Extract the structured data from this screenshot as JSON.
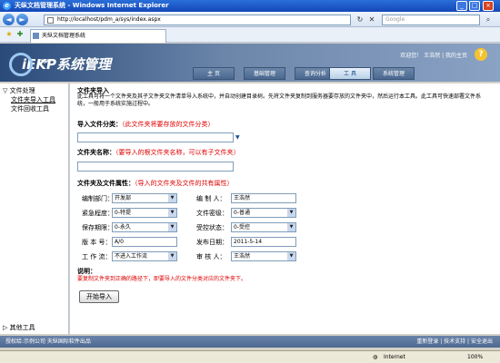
{
  "window": {
    "title": "天纵文档管理系统 - Windows Internet Explorer",
    "min": "_",
    "max": "□",
    "close": "×"
  },
  "browser": {
    "back": "◄",
    "forward": "►",
    "url": "http://localhost/pdm_a/sys/index.aspx",
    "refresh": "↻",
    "stop": "✕",
    "search_placeholder": "Google",
    "tab_title": "天纵文档管理系统",
    "fav_star": "★",
    "add_fav": "✚"
  },
  "header": {
    "logo_text": "iEKP系统管理",
    "logo_tm": "TM",
    "user": "欢迎您！ 王浩然",
    "links": "| 我的主页",
    "help": "?"
  },
  "nav_tabs": [
    {
      "label": "主  页"
    },
    {
      "label": "基础管理"
    },
    {
      "label": "查询分析"
    },
    {
      "label": "工  具"
    },
    {
      "label": "系统管理"
    }
  ],
  "sidebar": {
    "group1": "▽ 文件处理",
    "item1": "文件夹导入工具",
    "item2": "文件回收工具",
    "group2": "▷ 其他工具"
  },
  "main": {
    "title": "文件夹导入",
    "desc": "此工具可将一个文件夹及其子文件夹文件清单导入系统中，并自动创建目录树。先将文件夹复制到服务器要存放的文件夹中，然后运行本工具。此工具可快速部署文件系统，一般用于系统实施过程中。",
    "cat_label": "导入文件分类：",
    "cat_hint": "（此文件夹将要存放的文件分类）",
    "cat_value": "",
    "name_label": "文件夹名称：",
    "name_hint": "（要导入的根文件夹名称，可以有子文件夹）",
    "name_value": "",
    "attr_label": "文件夹及文件属性：",
    "attr_hint": "（导入的文件夹及文件的共有属性）",
    "fields": {
      "dept_label": "编制部门：",
      "dept_value": "开发部",
      "author_label": "编  制 人：",
      "author_value": "王浩然",
      "urgency_label": "紧急程度：",
      "urgency_value": "0-特提",
      "secret_label": "文件密级：",
      "secret_value": "0-普通",
      "keep_label": "保存期限：",
      "keep_value": "0-永久",
      "ctrl_label": "受控状态：",
      "ctrl_value": "0-受控",
      "version_label": "版  本 号：",
      "version_value": "A/0",
      "date_label": "发布日期：",
      "date_value": "2011-5-14",
      "flow_label": "工 作 流：",
      "flow_value": "不进入工作流",
      "approver_label": "审  核 人：",
      "approver_value": "王浩然"
    },
    "note_title": "说明：",
    "note_text": "要复制文件夹到正确的路径下，即要导入的文件分类对应的文件夹下。",
    "start_button": "开始导入"
  },
  "footer": {
    "left": "授权给:示例公司   天纵国际软件出品",
    "right": "重新登录 | 技术支持 | 安全退出"
  },
  "status": {
    "zone": "Internet",
    "zoom": "100%"
  }
}
